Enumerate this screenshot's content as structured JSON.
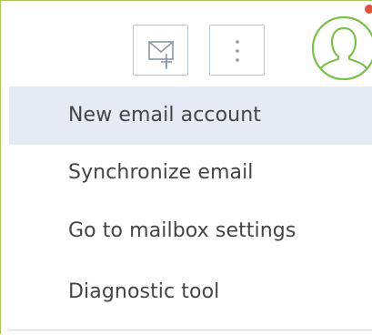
{
  "toolbar": {
    "new_email_icon": "envelope-plus-icon",
    "more_icon": "vertical-ellipsis-icon"
  },
  "user": {
    "avatar_icon": "user-silhouette-icon",
    "avatar_color": "#7cc04b",
    "notification_color": "#e2523c"
  },
  "menu": {
    "items": [
      {
        "label": "New email account",
        "highlighted": true
      },
      {
        "label": "Synchronize email",
        "highlighted": false
      },
      {
        "label": "Go to mailbox settings",
        "highlighted": false
      },
      {
        "label": "Diagnostic tool",
        "highlighted": false
      }
    ]
  },
  "colors": {
    "menu_highlight": "#e4ebf5",
    "frame_border": "#a8c95a",
    "button_border": "#b7c5d3",
    "icon_stroke": "#8a98a6",
    "text": "#444444"
  }
}
